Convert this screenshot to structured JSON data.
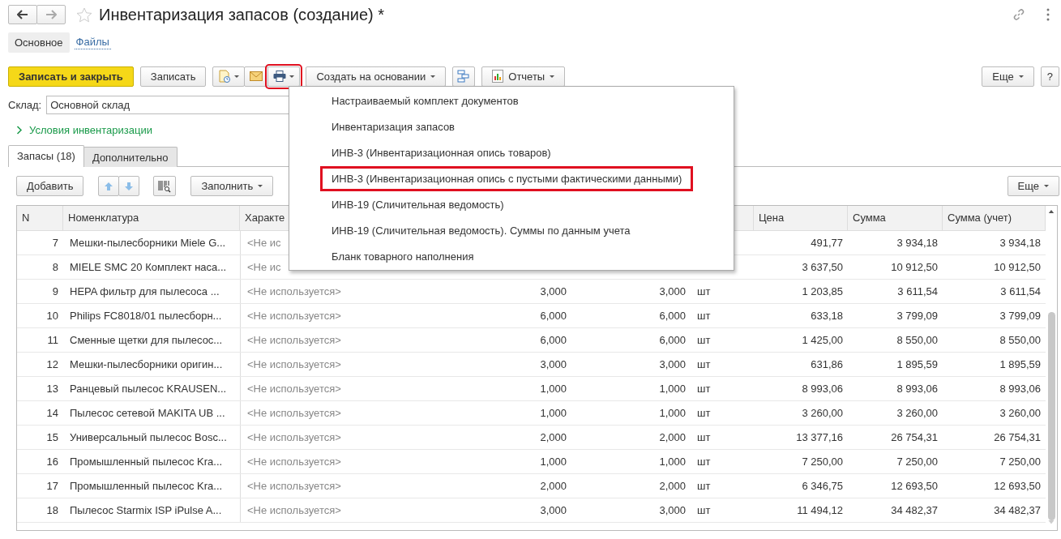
{
  "window": {
    "title": "Инвентаризация запасов (создание) *"
  },
  "nav_tabs": [
    {
      "label": "Основное",
      "selected": true
    },
    {
      "label": "Файлы",
      "selected": false
    }
  ],
  "toolbar": {
    "save_close": "Записать и закрыть",
    "save": "Записать",
    "print_highlighted": true,
    "create_based": "Создать на основании",
    "reports": "Отчеты",
    "more": "Еще",
    "help": "?"
  },
  "warehouse": {
    "label": "Склад:",
    "value": "Основной склад"
  },
  "conditions": {
    "label": "Условия инвентаризации",
    "expanded": false
  },
  "tabs": [
    {
      "label": "Запасы (18)",
      "selected": true
    },
    {
      "label": "Дополнительно",
      "selected": false
    }
  ],
  "table_toolbar": {
    "add": "Добавить",
    "fill": "Заполнить",
    "more": "Еще"
  },
  "table": {
    "columns": [
      "N",
      "Номенклатура",
      "Характе",
      "Цена",
      "Сумма",
      "Сумма (учет)"
    ],
    "rows": [
      {
        "n": "7",
        "name": "Мешки-пылесборники Miele G...",
        "characteristic": "<Не ис",
        "price": "491,77",
        "sum": "3 934,18",
        "sum_accounting": "3 934,18"
      },
      {
        "n": "8",
        "name": "MIELE SMC 20 Комплект наса...",
        "characteristic": "<Не ис",
        "price": "3 637,50",
        "sum": "10 912,50",
        "sum_accounting": "10 912,50"
      },
      {
        "n": "9",
        "name": "HEPA фильтр для пылесоса ...",
        "characteristic": "<Не используется>",
        "qty": "3,000",
        "qty_fact": "3,000",
        "unit": "шт",
        "price": "1 203,85",
        "sum": "3 611,54",
        "sum_accounting": "3 611,54"
      },
      {
        "n": "10",
        "name": "Philips FC8018/01 пылесборн...",
        "characteristic": "<Не используется>",
        "qty": "6,000",
        "qty_fact": "6,000",
        "unit": "шт",
        "price": "633,18",
        "sum": "3 799,09",
        "sum_accounting": "3 799,09"
      },
      {
        "n": "11",
        "name": "Сменные щетки для пылесос...",
        "characteristic": "<Не используется>",
        "qty": "6,000",
        "qty_fact": "6,000",
        "unit": "шт",
        "price": "1 425,00",
        "sum": "8 550,00",
        "sum_accounting": "8 550,00"
      },
      {
        "n": "12",
        "name": "Мешки-пылесборники оригин...",
        "characteristic": "<Не используется>",
        "qty": "3,000",
        "qty_fact": "3,000",
        "unit": "шт",
        "price": "631,86",
        "sum": "1 895,59",
        "sum_accounting": "1 895,59"
      },
      {
        "n": "13",
        "name": "Ранцевый пылесос KRAUSEN...",
        "characteristic": "<Не используется>",
        "qty": "1,000",
        "qty_fact": "1,000",
        "unit": "шт",
        "price": "8 993,06",
        "sum": "8 993,06",
        "sum_accounting": "8 993,06"
      },
      {
        "n": "14",
        "name": "Пылесос сетевой MAKITA UB ...",
        "characteristic": "<Не используется>",
        "qty": "1,000",
        "qty_fact": "1,000",
        "unit": "шт",
        "price": "3 260,00",
        "sum": "3 260,00",
        "sum_accounting": "3 260,00"
      },
      {
        "n": "15",
        "name": "Универсальный пылесос Bosc...",
        "characteristic": "<Не используется>",
        "qty": "2,000",
        "qty_fact": "2,000",
        "unit": "шт",
        "price": "13 377,16",
        "sum": "26 754,31",
        "sum_accounting": "26 754,31"
      },
      {
        "n": "16",
        "name": "Промышленный пылесос Kra...",
        "characteristic": "<Не используется>",
        "qty": "1,000",
        "qty_fact": "1,000",
        "unit": "шт",
        "price": "7 250,00",
        "sum": "7 250,00",
        "sum_accounting": "7 250,00"
      },
      {
        "n": "17",
        "name": "Промышленный пылесос Kra...",
        "characteristic": "<Не используется>",
        "qty": "2,000",
        "qty_fact": "2,000",
        "unit": "шт",
        "price": "6 346,75",
        "sum": "12 693,50",
        "sum_accounting": "12 693,50"
      },
      {
        "n": "18",
        "name": "Пылесос Starmix ISP iPulse A...",
        "characteristic": "<Не используется>",
        "qty": "3,000",
        "qty_fact": "3,000",
        "unit": "шт",
        "price": "11 494,12",
        "sum": "34 482,37",
        "sum_accounting": "34 482,37"
      }
    ]
  },
  "print_menu": {
    "items": [
      {
        "label": "Настраиваемый комплект документов",
        "selected": false
      },
      {
        "label": "Инвентаризация запасов",
        "selected": false
      },
      {
        "label": "ИНВ-3 (Инвентаризационная опись товаров)",
        "selected": false
      },
      {
        "label": "ИНВ-3 (Инвентаризационная опись с пустыми фактическими данными)",
        "selected": true
      },
      {
        "label": "ИНВ-19 (Сличительная ведомость)",
        "selected": false
      },
      {
        "label": "ИНВ-19 (Сличительная ведомость). Суммы по данным учета",
        "selected": false
      },
      {
        "label": "Бланк товарного наполнения",
        "selected": false
      }
    ]
  }
}
